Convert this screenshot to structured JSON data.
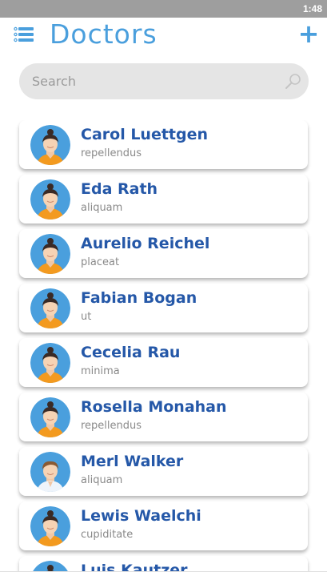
{
  "status_bar": {
    "time": "1:48"
  },
  "header": {
    "title": "Doctors",
    "add_label": "+"
  },
  "search": {
    "placeholder": "Search"
  },
  "colors": {
    "accent": "#4a9fdd",
    "name": "#2558a8",
    "subtitle": "#8a8a8a",
    "avatar_bg": "#4a9fdd"
  },
  "doctors": [
    {
      "name": "Carol Luettgen",
      "specialty": "repellendus",
      "avatar": "female"
    },
    {
      "name": "Eda Rath",
      "specialty": "aliquam",
      "avatar": "female"
    },
    {
      "name": "Aurelio Reichel",
      "specialty": "placeat",
      "avatar": "female"
    },
    {
      "name": "Fabian Bogan",
      "specialty": "ut",
      "avatar": "female"
    },
    {
      "name": "Cecelia Rau",
      "specialty": "minima",
      "avatar": "female"
    },
    {
      "name": "Rosella Monahan",
      "specialty": "repellendus",
      "avatar": "female"
    },
    {
      "name": "Merl Walker",
      "specialty": "aliquam",
      "avatar": "male"
    },
    {
      "name": "Lewis Waelchi",
      "specialty": "cupiditate",
      "avatar": "female"
    },
    {
      "name": "Luis Kautzer",
      "specialty": "",
      "avatar": "female"
    }
  ]
}
